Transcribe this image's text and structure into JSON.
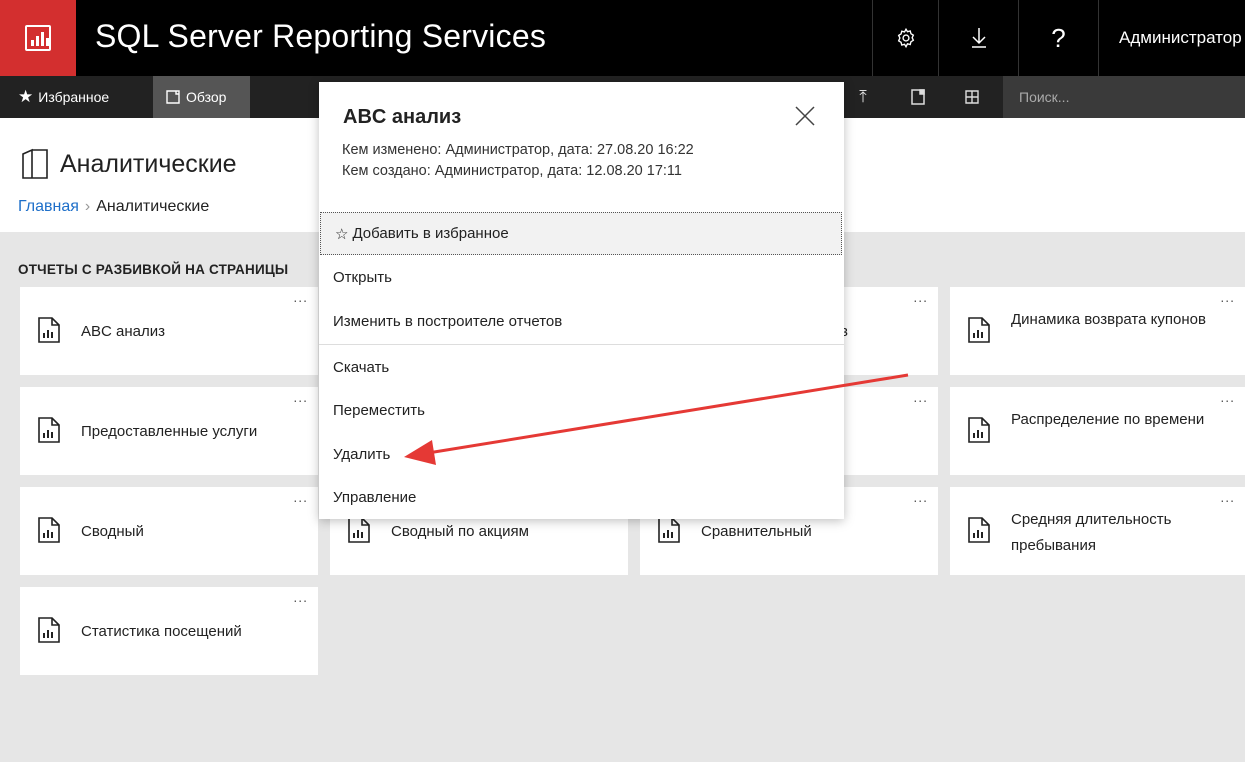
{
  "header": {
    "app_title": "SQL Server Reporting Services",
    "user_name": "Администратор",
    "icons": [
      "settings-gear-icon",
      "download-arrow-icon",
      "help-question-icon"
    ]
  },
  "nav": {
    "favorites_label": "Избранное",
    "browse_label": "Обзор",
    "search_placeholder": "Поиск..."
  },
  "page": {
    "title": "Аналитические",
    "breadcrumb_home": "Главная",
    "breadcrumb_current": "Аналитические",
    "section_title": "ОТЧЕТЫ С РАЗБИВКОЙ НА СТРАНИЦЫ"
  },
  "tiles": [
    {
      "label": "ABC анализ"
    },
    {
      "label": "Динамика возврата купонов"
    },
    {
      "label": "Предоставленные услуги"
    },
    {
      "label": "Распределение по времени"
    },
    {
      "label": "Сводный"
    },
    {
      "label": "Сводный по акциям"
    },
    {
      "label": "Сравнительный"
    },
    {
      "label": "Средняя длительность пребывания"
    },
    {
      "label": "Статистика посещений"
    },
    {
      "label": "в"
    }
  ],
  "tile_more_label": "...",
  "popup": {
    "title": "ABC анализ",
    "modified": "Кем изменено: Администратор, дата: 27.08.20 16:22",
    "created": "Кем создано: Администратор, дата: 12.08.20 17:11",
    "menu": {
      "favorite": "Добавить в избранное",
      "open": "Открыть",
      "edit": "Изменить в построителе отчетов",
      "download": "Скачать",
      "move": "Переместить",
      "delete": "Удалить",
      "manage": "Управление"
    }
  },
  "colors": {
    "brand_red": "#d32f2f",
    "link_blue": "#1e6fc9",
    "arrow_red": "#e53935"
  }
}
